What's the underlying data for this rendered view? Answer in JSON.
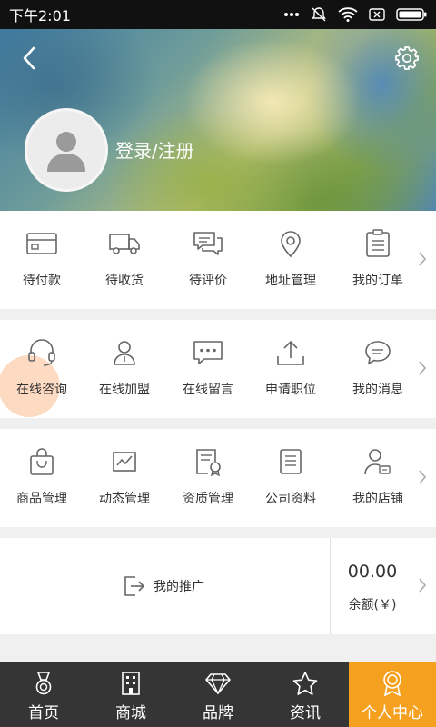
{
  "status_bar": {
    "time": "下午2:01"
  },
  "profile": {
    "login_label": "登录/注册"
  },
  "sections": [
    {
      "items": [
        {
          "label": "待付款",
          "icon": "wallet-icon"
        },
        {
          "label": "待收货",
          "icon": "truck-icon"
        },
        {
          "label": "待评价",
          "icon": "chat-bubbles-icon"
        },
        {
          "label": "地址管理",
          "icon": "location-pin-icon"
        }
      ],
      "side": {
        "label": "我的订单",
        "icon": "clipboard-list-icon"
      }
    },
    {
      "items": [
        {
          "label": "在线咨询",
          "icon": "headset-icon"
        },
        {
          "label": "在线加盟",
          "icon": "person-join-icon"
        },
        {
          "label": "在线留言",
          "icon": "message-dots-icon"
        },
        {
          "label": "申请职位",
          "icon": "upload-icon"
        }
      ],
      "side": {
        "label": "我的消息",
        "icon": "speech-bubble-icon"
      }
    },
    {
      "items": [
        {
          "label": "商品管理",
          "icon": "shopping-bag-icon"
        },
        {
          "label": "动态管理",
          "icon": "trend-chart-icon"
        },
        {
          "label": "资质管理",
          "icon": "certificate-icon"
        },
        {
          "label": "公司资料",
          "icon": "document-list-icon"
        }
      ],
      "side": {
        "label": "我的店铺",
        "icon": "shop-owner-icon"
      }
    }
  ],
  "promo": {
    "label": "我的推广",
    "balance_value": "00.00",
    "balance_label": "余额(￥)"
  },
  "tabbar": {
    "tabs": [
      {
        "label": "首页",
        "icon": "medal-icon",
        "active": false
      },
      {
        "label": "商城",
        "icon": "building-icon",
        "active": false
      },
      {
        "label": "品牌",
        "icon": "diamond-icon",
        "active": false
      },
      {
        "label": "资讯",
        "icon": "star-badge-icon",
        "active": false
      },
      {
        "label": "个人中心",
        "icon": "award-badge-icon",
        "active": true
      }
    ]
  },
  "colors": {
    "accent": "#f5a01e",
    "tabbar_bg": "#353535",
    "icon_gray": "#666666"
  }
}
